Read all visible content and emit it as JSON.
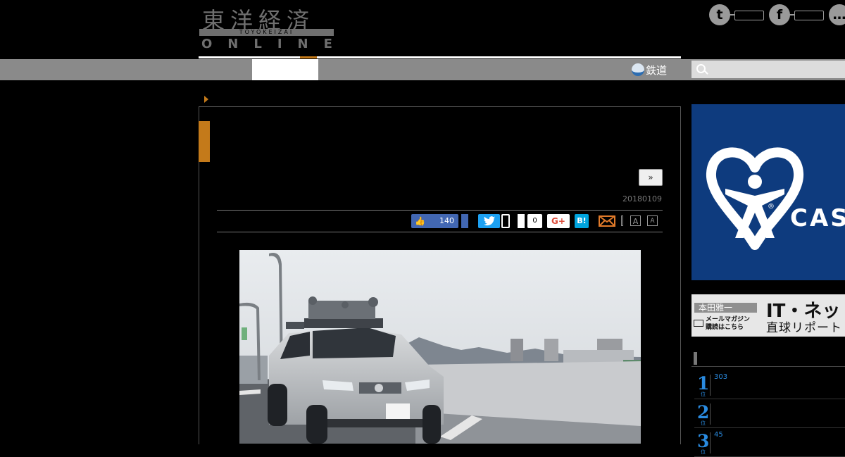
{
  "brand": {
    "logo_kanji": "東洋経済",
    "logo_sub": "TOYOKEIZAI",
    "logo_online": "ONLINE"
  },
  "social": [
    {
      "name": "twitter",
      "icon": "twitter-icon",
      "glyph": "t"
    },
    {
      "name": "facebook",
      "icon": "facebook-icon",
      "glyph": "f"
    },
    {
      "name": "line",
      "icon": "line-icon",
      "glyph": "…"
    }
  ],
  "nav": {
    "rail_label": "鉄道",
    "search_placeholder": ""
  },
  "article": {
    "next_label": "»",
    "date": "20180109",
    "share": {
      "like_count": "140",
      "pocket_count": "0",
      "gplus_label": "G+",
      "hatena_label": "B!",
      "font_large": "A",
      "font_small": "A"
    }
  },
  "sidebar": {
    "ad": {
      "text": "CAS",
      "reg": "®"
    },
    "banner": {
      "author": "本田雅一",
      "mail_line1": "メールマガジン",
      "mail_line2": "購読はこちら",
      "headline": "IT・ネット",
      "subline": "直球リポート"
    },
    "ranking": [
      {
        "rank": "1",
        "suffix": "位",
        "count": "303"
      },
      {
        "rank": "2",
        "suffix": "位",
        "count": ""
      },
      {
        "rank": "3",
        "suffix": "位",
        "count": "45"
      }
    ]
  },
  "colors": {
    "accent": "#c47a1a",
    "nav_gray": "#8a8a8a",
    "ad_blue": "#0e3b7e",
    "rank_blue": "#2a8be0",
    "facebook": "#4267b2",
    "twitter": "#1da1f2"
  }
}
